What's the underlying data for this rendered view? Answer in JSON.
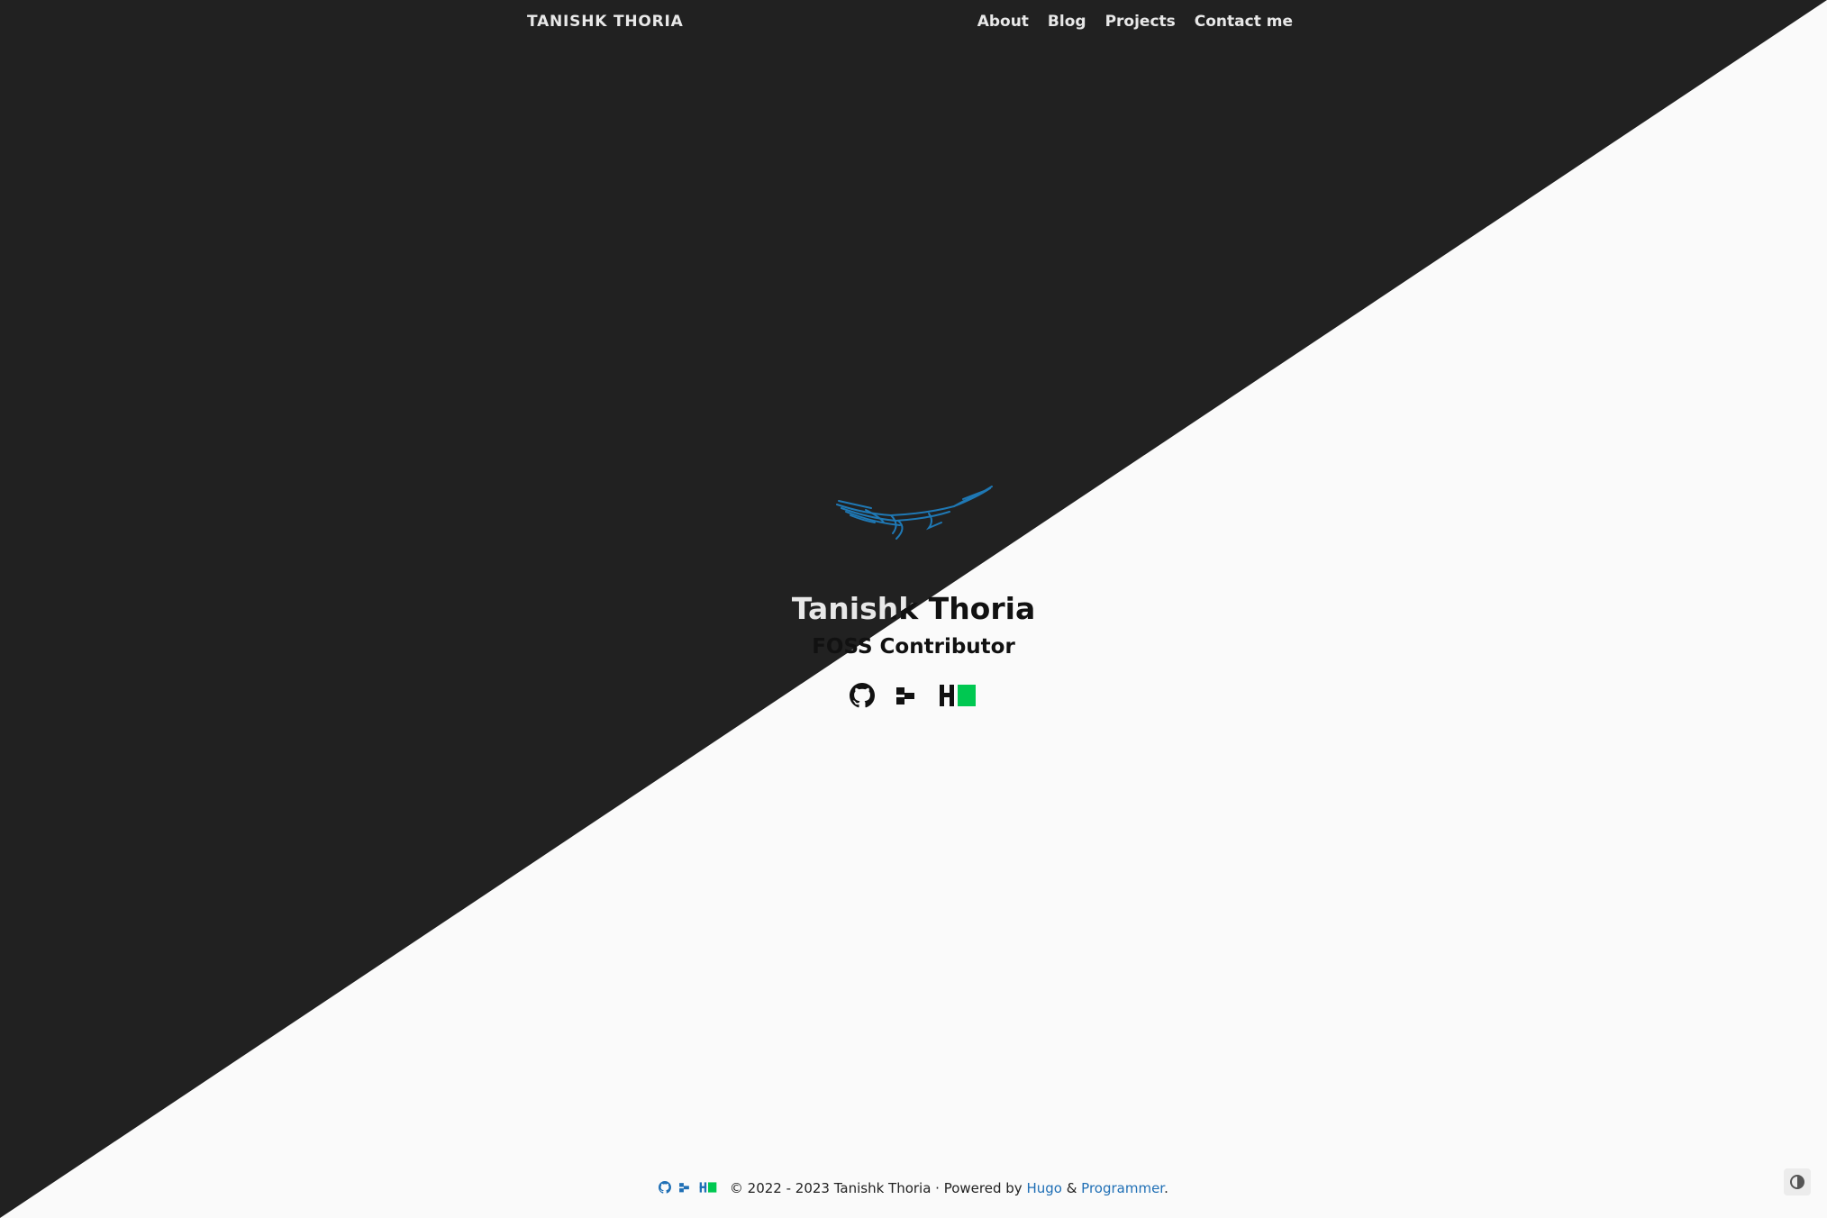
{
  "header": {
    "site_title": "TANISHK THORIA",
    "nav": [
      "About",
      "Blog",
      "Projects",
      "Contact me"
    ]
  },
  "hero": {
    "name": "Tanishk Thoria",
    "subtitle": "FOSS Contributor",
    "social_icons": [
      "github-icon",
      "dev-icon",
      "hashnode-icon"
    ]
  },
  "footer": {
    "copyright": "© 2022 - 2023 Tanishk Thoria · Powered by ",
    "hugo": "Hugo",
    "amp": " & ",
    "programmer": "Programmer",
    "period": "."
  },
  "colors": {
    "dark_bg": "#212121",
    "light_bg": "#fafafa",
    "accent_blue": "#1f6fb5",
    "hashnode_green": "#00c851"
  }
}
